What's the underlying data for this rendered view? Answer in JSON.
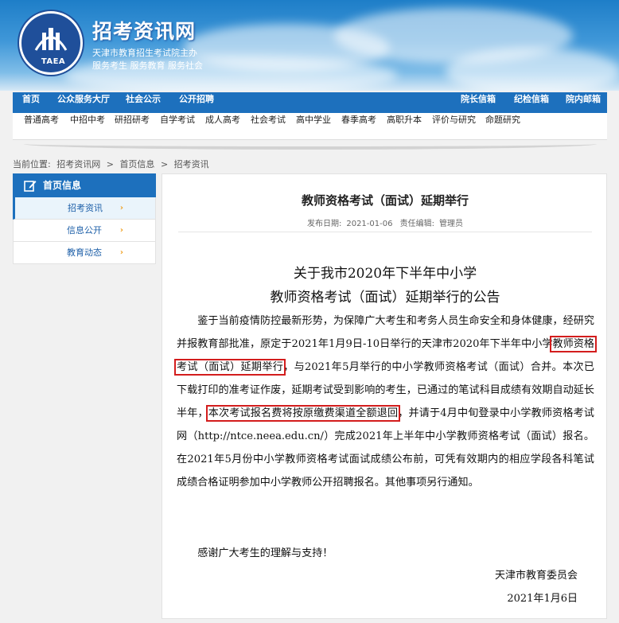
{
  "site": {
    "title": "招考资讯网",
    "subtitle1": "天津市教育招生考试院主办",
    "subtitle2": "服务考生 服务教育 服务社会",
    "logo_text": "TAEA"
  },
  "nav_primary_left": [
    "首页",
    "公众服务大厅",
    "社会公示",
    "公开招聘"
  ],
  "nav_primary_right": [
    "院长信箱",
    "纪检信箱",
    "院内邮箱"
  ],
  "nav_secondary": [
    "普通高考",
    "中招中考",
    "研招研考",
    "自学考试",
    "成人高考",
    "社会考试",
    "高中学业",
    "春季高考",
    "高职升本",
    "评价与研究",
    "命题研究"
  ],
  "breadcrumb": {
    "prefix": "当前位置:",
    "items": [
      "招考资讯网",
      "首页信息",
      "招考资讯"
    ],
    "sep": ">"
  },
  "sidebar": {
    "header": "首页信息",
    "items": [
      {
        "label": "招考资讯",
        "chevron": "›",
        "active": true
      },
      {
        "label": "信息公开",
        "chevron": "›",
        "active": false
      },
      {
        "label": "教育动态",
        "chevron": "›",
        "active": false
      }
    ]
  },
  "article": {
    "title": "教师资格考试（面试）延期举行",
    "meta": {
      "date_label": "发布日期:",
      "date": "2021-01-06",
      "editor_label": "责任编辑:",
      "editor": "管理员"
    },
    "notice_title_line1": "关于我市2020年下半年中小学",
    "notice_title_line2": "教师资格考试（面试）延期举行的公告",
    "p1_part1": "鉴于当前疫情防控最新形势，为保障广大考生和考务人员生命安全和身体健康，经研究并报教育部批准，原定于2021年1月9日-10日举行的天津市2020年下半年中小学",
    "p1_highlight1": "教师资格考试（面试）延期举行",
    "p1_part2": "，与2021年5月举行的中小学教师资格考试（面试）合并。本次已下载打印的准考证作废，延期考试受到影响的考生，已通过的笔试科目成绩有效期自动延长半年，",
    "p1_highlight2": "本次考试报名费将按原缴费渠道全额退回",
    "p1_part3": "，并请于4月中旬登录中小学教师资格考试网（http://ntce.neea.edu.cn/）完成2021年上半年中小学教师资格考试（面试）报名。在2021年5月份中小学教师资格考试面试成绩公布前，可凭有效期内的相应学段各科笔试成绩合格证明参加中小学教师公开招聘报名。其他事项另行通知。",
    "p2": "感谢广大考生的理解与支持！",
    "signature": "天津市教育委员会",
    "sign_date": "2021年1月6日"
  },
  "colors": {
    "brand_blue": "#1d70bd",
    "highlight_red": "#d31d1d",
    "chevron": "#f0a020"
  }
}
